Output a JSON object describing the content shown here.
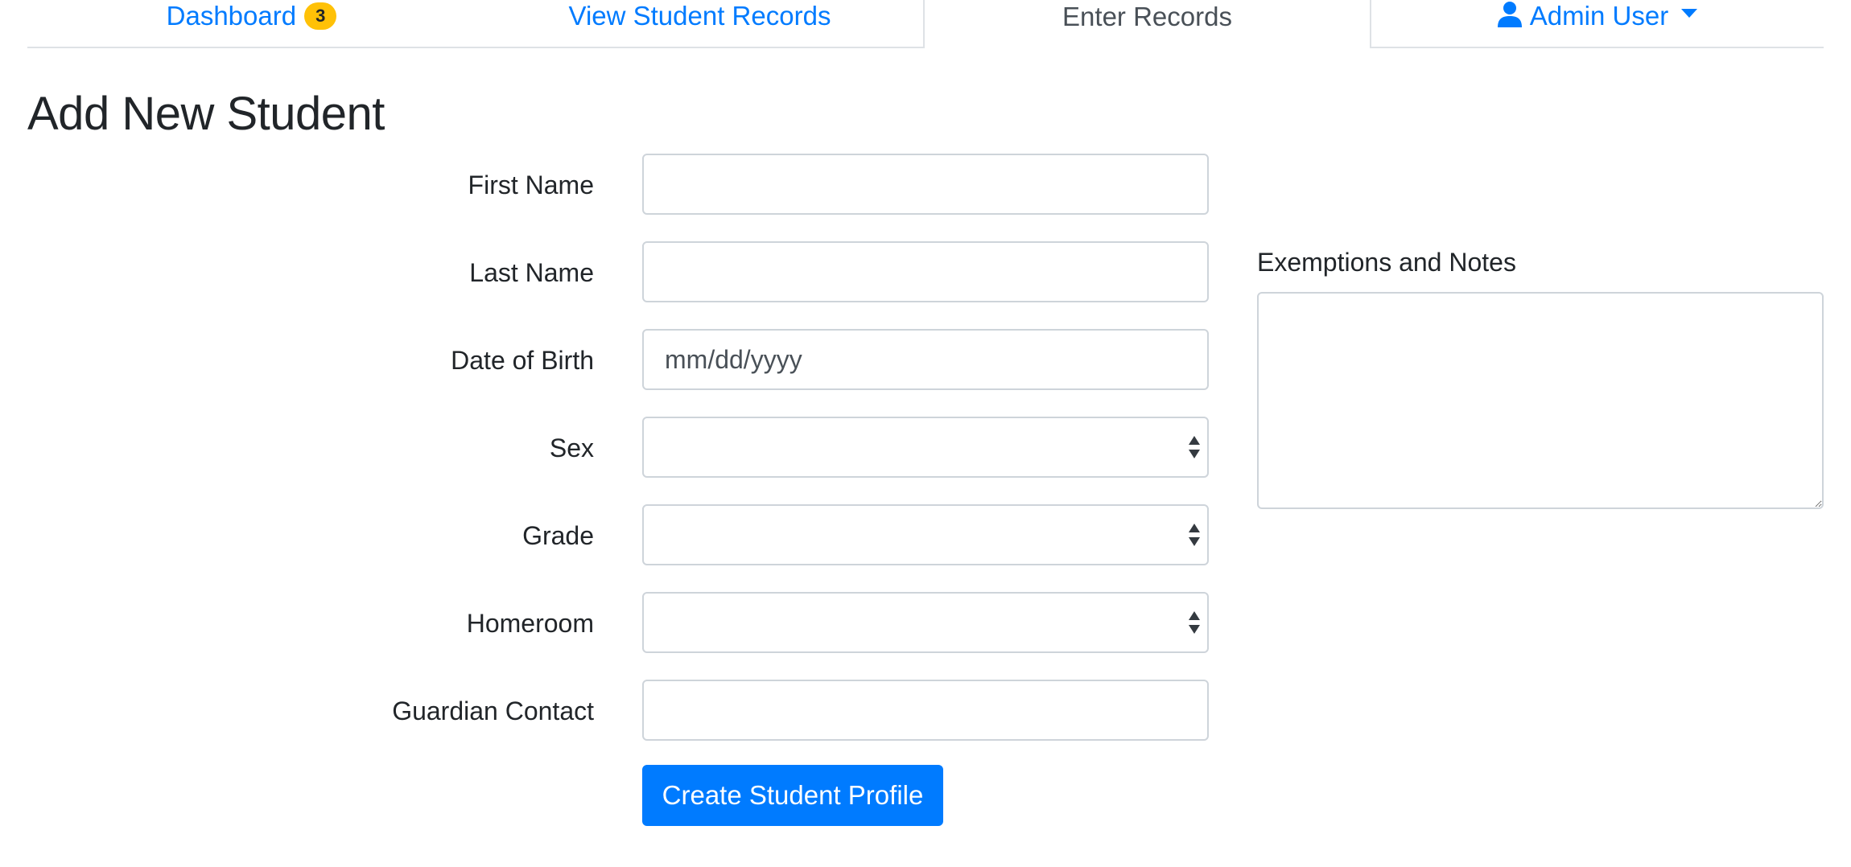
{
  "tabs": {
    "dashboard": {
      "label": "Dashboard",
      "badge": "3"
    },
    "view_records": {
      "label": "View Student Records"
    },
    "enter_records": {
      "label": "Enter Records",
      "active": true
    },
    "admin": {
      "label": "Admin User",
      "icon": "user-icon"
    }
  },
  "page": {
    "title": "Add New Student"
  },
  "form": {
    "first_name": {
      "label": "First Name",
      "value": "",
      "placeholder": ""
    },
    "last_name": {
      "label": "Last Name",
      "value": "",
      "placeholder": ""
    },
    "date_of_birth": {
      "label": "Date of Birth",
      "value": "",
      "placeholder": "mm/dd/yyyy"
    },
    "sex": {
      "label": "Sex",
      "selected": ""
    },
    "grade": {
      "label": "Grade",
      "selected": ""
    },
    "homeroom": {
      "label": "Homeroom",
      "selected": ""
    },
    "guardian_contact": {
      "label": "Guardian Contact",
      "value": "",
      "placeholder": ""
    },
    "notes": {
      "label": "Exemptions and Notes",
      "value": ""
    },
    "submit_label": "Create Student Profile"
  },
  "colors": {
    "link": "#007bff",
    "badge": "#ffc107",
    "border": "#ced4da",
    "text": "#212529"
  }
}
